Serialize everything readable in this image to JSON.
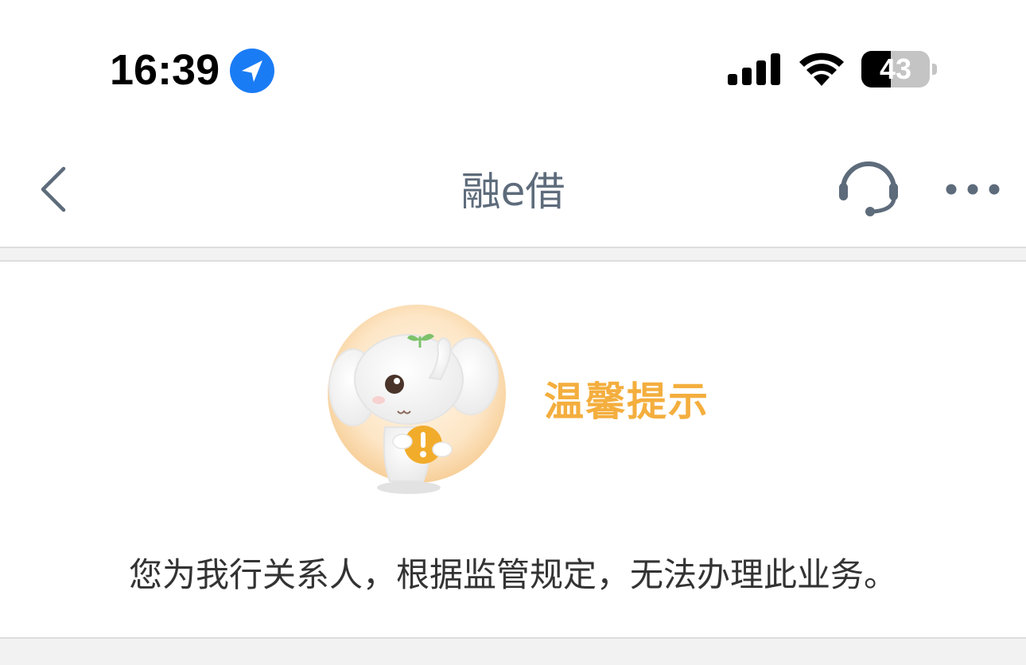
{
  "status_bar": {
    "time": "16:39",
    "battery_level": "43",
    "battery_fraction": 0.43,
    "icons": [
      "location-arrow-icon",
      "cellular-signal-icon",
      "wifi-icon",
      "battery-icon"
    ],
    "location_color": "#1a7cf5"
  },
  "nav": {
    "title": "融e借",
    "back_icon": "chevron-left-icon",
    "service_icon": "headset-icon",
    "more_icon": "more-dots-icon",
    "icon_color": "#5d6b7b"
  },
  "notice": {
    "title": "温馨提示",
    "message": "您为我行关系人，根据监管规定，无法办理此业务。",
    "title_color": "#f4ae3e",
    "mascot_icon": "elephant-mascot-warning-icon"
  }
}
